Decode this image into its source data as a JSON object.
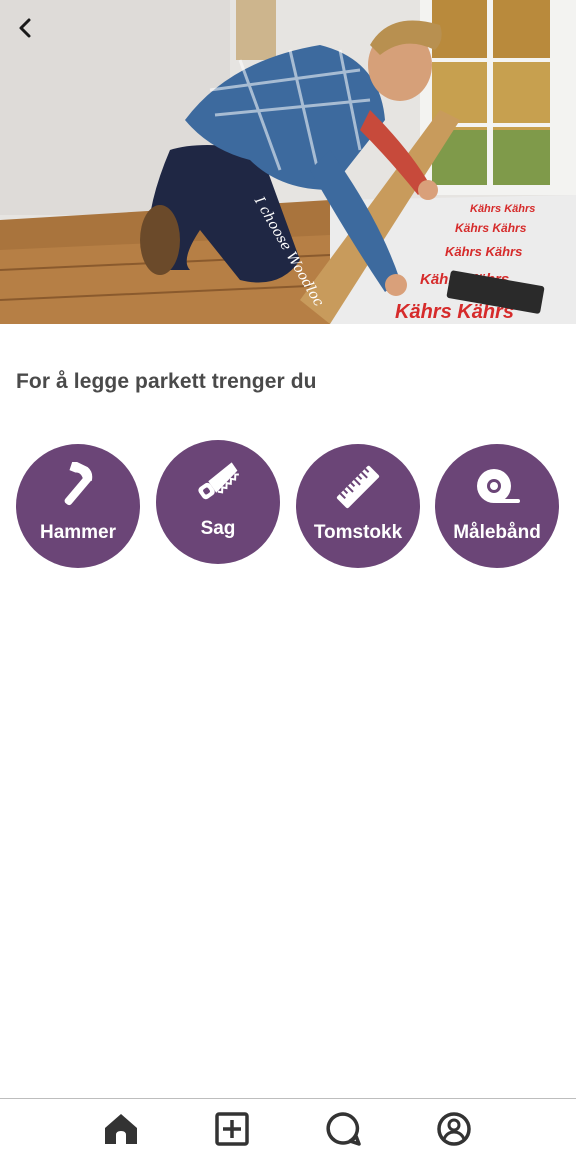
{
  "hero": {
    "image": "man-laying-parquet-floor-photo",
    "mat_text": "Kährs",
    "leg_text": "I choose Woodloc"
  },
  "header": {
    "back_icon": "chevron-left-icon"
  },
  "section": {
    "title": "For å legge parkett trenger du"
  },
  "tools": [
    {
      "label": "Hammer",
      "icon": "hammer-icon"
    },
    {
      "label": "Sag",
      "icon": "saw-icon"
    },
    {
      "label": "Tomstokk",
      "icon": "ruler-icon"
    },
    {
      "label": "Målebånd",
      "icon": "measuring-tape-icon"
    }
  ],
  "nav": {
    "items": [
      {
        "icon": "home-icon",
        "active": true
      },
      {
        "icon": "plus-square-icon",
        "active": false
      },
      {
        "icon": "chat-bubble-icon",
        "active": false
      },
      {
        "icon": "profile-icon",
        "active": false
      }
    ]
  },
  "colors": {
    "accent": "#6b4577",
    "text": "#4a4a4a",
    "icon": "#333333"
  }
}
